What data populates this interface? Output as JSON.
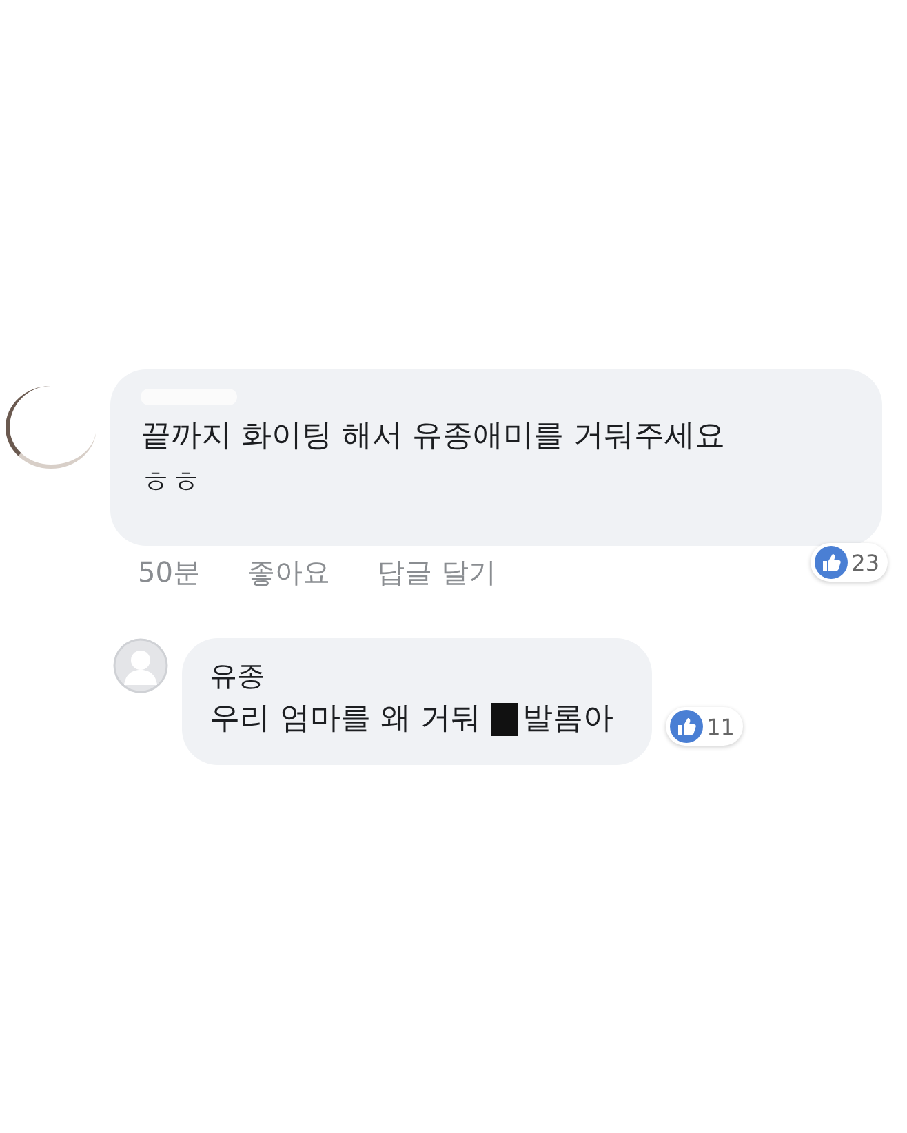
{
  "comment": {
    "text": "끝까지 화이팅 해서 유종애미를 거둬주세요 ㅎㅎ",
    "likes": "23",
    "time": "50분",
    "actions": [
      "좋아요",
      "답글 달기"
    ]
  },
  "reply": {
    "author": "유종",
    "text_parts": [
      "우리 엄마를 왜 거둬",
      "발롬아"
    ],
    "redacted": true,
    "likes": "11"
  }
}
